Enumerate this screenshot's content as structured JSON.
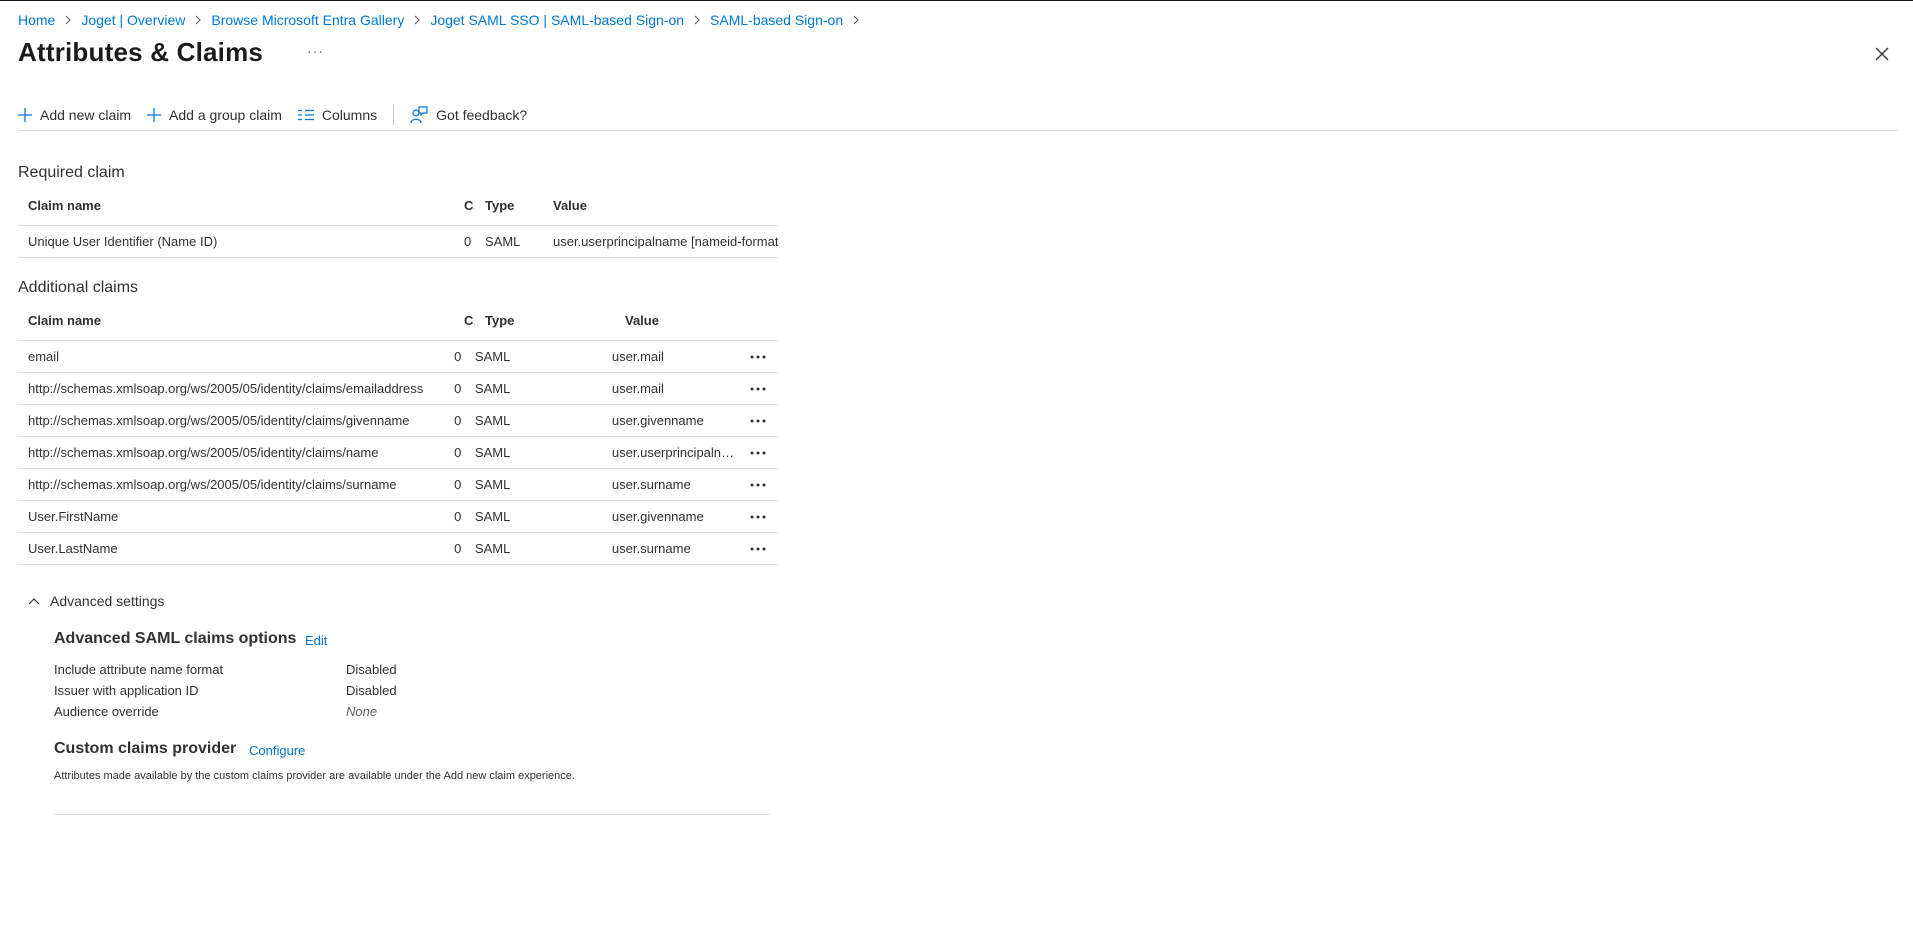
{
  "breadcrumb": [
    "Home",
    "Joget | Overview",
    "Browse Microsoft Entra Gallery",
    "Joget SAML SSO | SAML-based Sign-on",
    "SAML-based Sign-on"
  ],
  "header": {
    "title": "Attributes & Claims",
    "more": "···"
  },
  "toolbar": {
    "add_claim": "Add new claim",
    "add_group_claim": "Add a group claim",
    "columns": "Columns",
    "feedback": "Got feedback?"
  },
  "required": {
    "title": "Required claim",
    "columns": {
      "name": "Claim name",
      "co": "Co",
      "type": "Type",
      "value": "Value"
    },
    "rows": [
      {
        "name": "Unique User Identifier (Name ID)",
        "co": "0",
        "type": "SAML",
        "value": "user.userprincipalname [nameid-format:"
      }
    ]
  },
  "additional": {
    "title": "Additional claims",
    "columns": {
      "name": "Claim name",
      "co": "Co",
      "type": "Type",
      "value": "Value"
    },
    "rows": [
      {
        "name": "email",
        "co": "0",
        "type": "SAML",
        "value": "user.mail"
      },
      {
        "name": "http://schemas.xmlsoap.org/ws/2005/05/identity/claims/emailaddress",
        "co": "0",
        "type": "SAML",
        "value": "user.mail"
      },
      {
        "name": "http://schemas.xmlsoap.org/ws/2005/05/identity/claims/givenname",
        "co": "0",
        "type": "SAML",
        "value": "user.givenname"
      },
      {
        "name": "http://schemas.xmlsoap.org/ws/2005/05/identity/claims/name",
        "co": "0",
        "type": "SAML",
        "value": "user.userprincipalna..."
      },
      {
        "name": "http://schemas.xmlsoap.org/ws/2005/05/identity/claims/surname",
        "co": "0",
        "type": "SAML",
        "value": "user.surname"
      },
      {
        "name": "User.FirstName",
        "co": "0",
        "type": "SAML",
        "value": "user.givenname"
      },
      {
        "name": "User.LastName",
        "co": "0",
        "type": "SAML",
        "value": "user.surname"
      }
    ]
  },
  "advanced": {
    "toggle_label": "Advanced settings",
    "saml_options": {
      "title": "Advanced SAML claims options",
      "edit": "Edit",
      "items": [
        {
          "label": "Include attribute name format",
          "value": "Disabled"
        },
        {
          "label": "Issuer with application ID",
          "value": "Disabled"
        },
        {
          "label": "Audience override",
          "value": "None"
        }
      ]
    },
    "custom_provider": {
      "title": "Custom claims provider",
      "configure": "Configure",
      "note": "Attributes made available by the custom claims provider are available under the Add new claim experience."
    }
  }
}
